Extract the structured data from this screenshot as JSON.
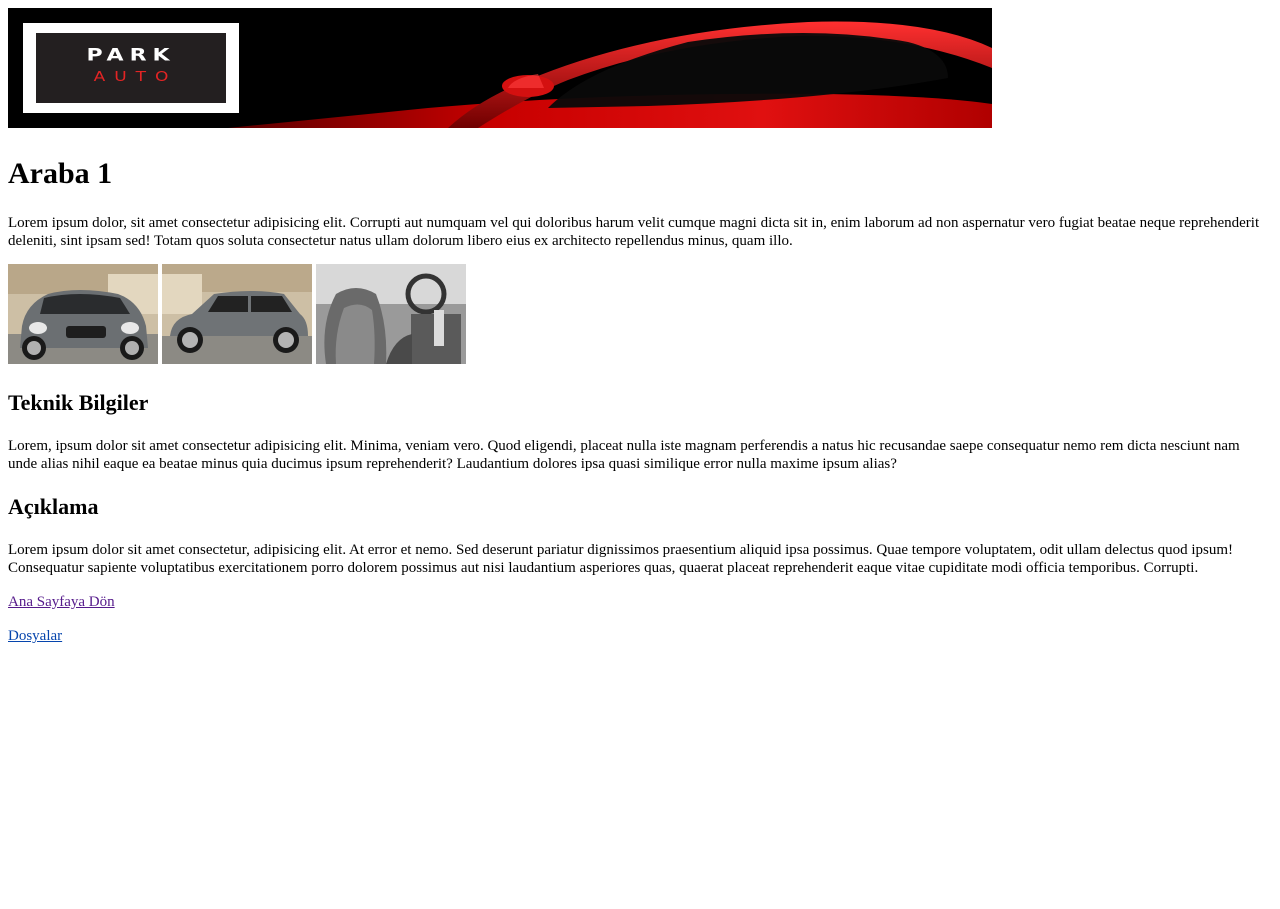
{
  "header": {
    "logo_top": "PARK",
    "logo_bottom": "AUTO",
    "logo_color_bottom": "#e32424",
    "banner_accent": "#d40000"
  },
  "main": {
    "title": "Araba 1",
    "intro": "Lorem ipsum dolor, sit amet consectetur adipisicing elit. Corrupti aut numquam vel qui doloribus harum velit cumque magni dicta sit in, enim laborum ad non aspernatur vero fugiat beatae neque reprehenderit deleniti, sint ipsam sed! Totam quos soluta consectetur natus ullam dolorum libero eius ex architecto repellendus minus, quam illo.",
    "gallery": [
      {
        "icon": "car-front-photo"
      },
      {
        "icon": "car-side-photo"
      },
      {
        "icon": "car-interior-photo"
      }
    ],
    "tech_heading": "Teknik Bilgiler",
    "tech_text": "Lorem, ipsum dolor sit amet consectetur adipisicing elit. Minima, veniam vero. Quod eligendi, placeat nulla iste magnam perferendis a natus hic recusandae saepe consequatur nemo rem dicta nesciunt nam unde alias nihil eaque ea beatae minus quia ducimus ipsum reprehenderit? Laudantium dolores ipsa quasi similique error nulla maxime ipsum alias?",
    "desc_heading": "Açıklama",
    "desc_text": "Lorem ipsum dolor sit amet consectetur, adipisicing elit. At error et nemo. Sed deserunt pariatur dignissimos praesentium aliquid ipsa possimus. Quae tempore voluptatem, odit ullam delectus quod ipsum! Consequatur sapiente voluptatibus exercitationem porro dolorem possimus aut nisi laudantium asperiores quas, quaerat placeat reprehenderit eaque vitae cupiditate modi officia temporibus. Corrupti."
  },
  "links": {
    "home": "Ana Sayfaya Dön",
    "files": "Dosyalar",
    "visited_color": "#551a8b",
    "link_color": "#0645ad"
  }
}
